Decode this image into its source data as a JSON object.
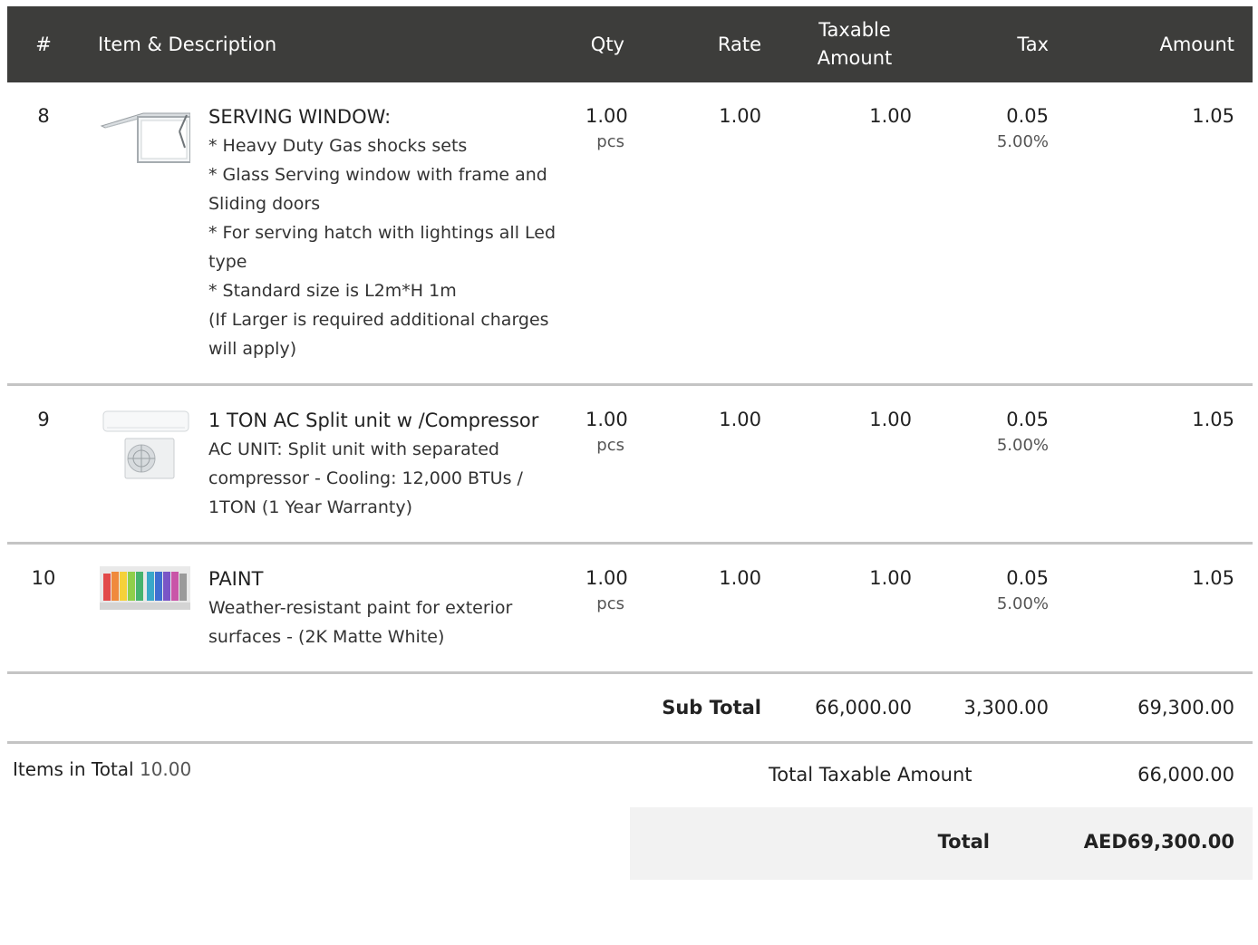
{
  "table": {
    "headers": {
      "num": "#",
      "item": "Item & Description",
      "qty": "Qty",
      "rate": "Rate",
      "taxable_line1": "Taxable",
      "taxable_line2": "Amount",
      "tax": "Tax",
      "amount": "Amount"
    },
    "rows": [
      {
        "num": "8",
        "name": "SERVING WINDOW:",
        "desc": [
          "* Heavy Duty Gas shocks sets",
          "* Glass Serving window with frame and Sliding doors",
          "* For serving hatch with lightings all Led type",
          "* Standard size is L2m*H 1m",
          "(If Larger is required additional charges will apply)"
        ],
        "qty": "1.00",
        "unit": "pcs",
        "rate": "1.00",
        "taxable": "1.00",
        "tax": "0.05",
        "tax_rate": "5.00%",
        "amount": "1.05"
      },
      {
        "num": "9",
        "name": "1 TON AC Split unit w /Compressor",
        "desc": [
          "AC UNIT: Split unit with separated",
          "compressor - Cooling: 12,000 BTUs / 1TON (1 Year Warranty)"
        ],
        "qty": "1.00",
        "unit": "pcs",
        "rate": "1.00",
        "taxable": "1.00",
        "tax": "0.05",
        "tax_rate": "5.00%",
        "amount": "1.05"
      },
      {
        "num": "10",
        "name": "PAINT",
        "desc": [
          "Weather-resistant paint for exterior surfaces - (2K Matte White)"
        ],
        "qty": "1.00",
        "unit": "pcs",
        "rate": "1.00",
        "taxable": "1.00",
        "tax": "0.05",
        "tax_rate": "5.00%",
        "amount": "1.05"
      }
    ],
    "subtotal": {
      "label": "Sub Total",
      "taxable": "66,000.00",
      "tax": "3,300.00",
      "amount": "69,300.00"
    }
  },
  "summary": {
    "items_in_total_label": "Items in Total",
    "items_in_total_value": "10.00",
    "total_taxable_label": "Total Taxable Amount",
    "total_taxable_value": "66,000.00",
    "total_label": "Total",
    "total_value": "AED69,300.00"
  },
  "colors": {
    "header_bg": "#3d3d3b",
    "row_border": "#c4c4c4",
    "total_bg": "#f2f2f2"
  },
  "icons": [
    "serving-window-image",
    "ac-split-unit-image",
    "paint-swatches-image"
  ]
}
